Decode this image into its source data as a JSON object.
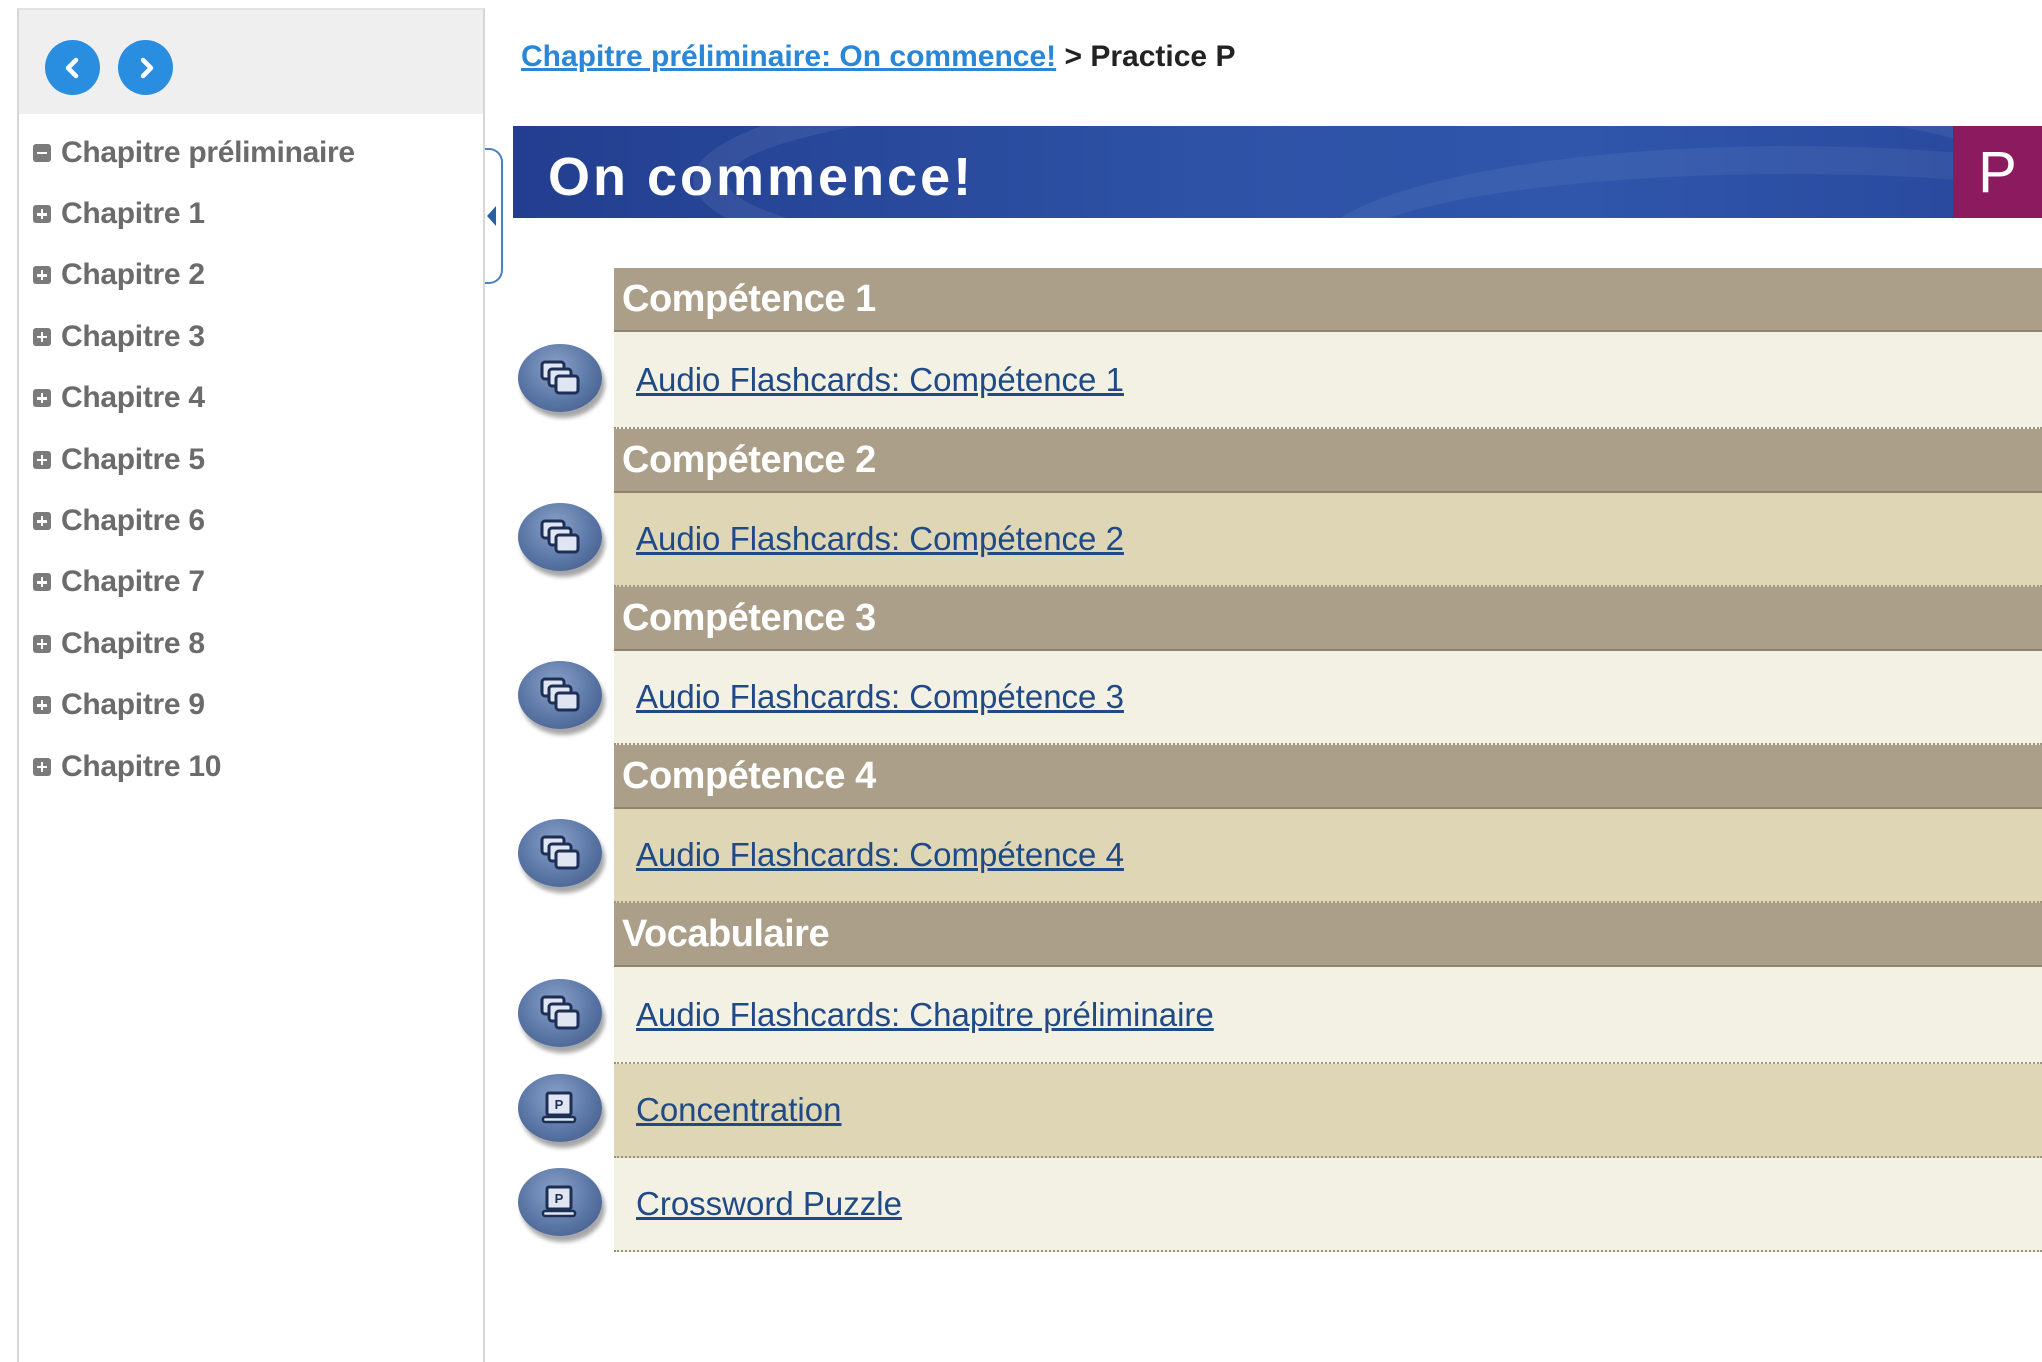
{
  "sidebar": {
    "items": [
      {
        "label": "Chapitre préliminaire",
        "state": "expanded"
      },
      {
        "label": "Chapitre 1",
        "state": "collapsed"
      },
      {
        "label": "Chapitre 2",
        "state": "collapsed"
      },
      {
        "label": "Chapitre 3",
        "state": "collapsed"
      },
      {
        "label": "Chapitre 4",
        "state": "collapsed"
      },
      {
        "label": "Chapitre 5",
        "state": "collapsed"
      },
      {
        "label": "Chapitre 6",
        "state": "collapsed"
      },
      {
        "label": "Chapitre 7",
        "state": "collapsed"
      },
      {
        "label": "Chapitre 8",
        "state": "collapsed"
      },
      {
        "label": "Chapitre 9",
        "state": "collapsed"
      },
      {
        "label": "Chapitre 10",
        "state": "collapsed"
      }
    ]
  },
  "breadcrumb": {
    "link": "Chapitre préliminaire: On commence!",
    "separator": ">",
    "current": "Practice P"
  },
  "banner": {
    "title": "On commence!",
    "badge": "P"
  },
  "sections": [
    {
      "title": "Compétence 1",
      "items": [
        {
          "label": "Audio Flashcards: Compétence 1",
          "icon": "flashcards-icon"
        }
      ]
    },
    {
      "title": "Compétence 2",
      "items": [
        {
          "label": "Audio Flashcards: Compétence 2",
          "icon": "flashcards-icon"
        }
      ]
    },
    {
      "title": "Compétence 3",
      "items": [
        {
          "label": "Audio Flashcards: Compétence 3",
          "icon": "flashcards-icon"
        }
      ]
    },
    {
      "title": "Compétence 4",
      "items": [
        {
          "label": "Audio Flashcards: Compétence 4",
          "icon": "flashcards-icon"
        }
      ]
    },
    {
      "title": "Vocabulaire",
      "items": [
        {
          "label": "Audio Flashcards: Chapitre préliminaire",
          "icon": "flashcards-icon"
        },
        {
          "label": "Concentration",
          "icon": "practice-icon"
        },
        {
          "label": "Crossword Puzzle",
          "icon": "practice-icon"
        }
      ]
    }
  ],
  "colors": {
    "nav_button": "#2a8ee0",
    "banner": "#2d52a6",
    "badge": "#8b1a5f",
    "section_header": "#ab9f89",
    "row_light": "#f3f0e4",
    "row_dark": "#ded6b4",
    "link": "#1f4a86",
    "breadcrumb_link": "#2a86d6"
  }
}
